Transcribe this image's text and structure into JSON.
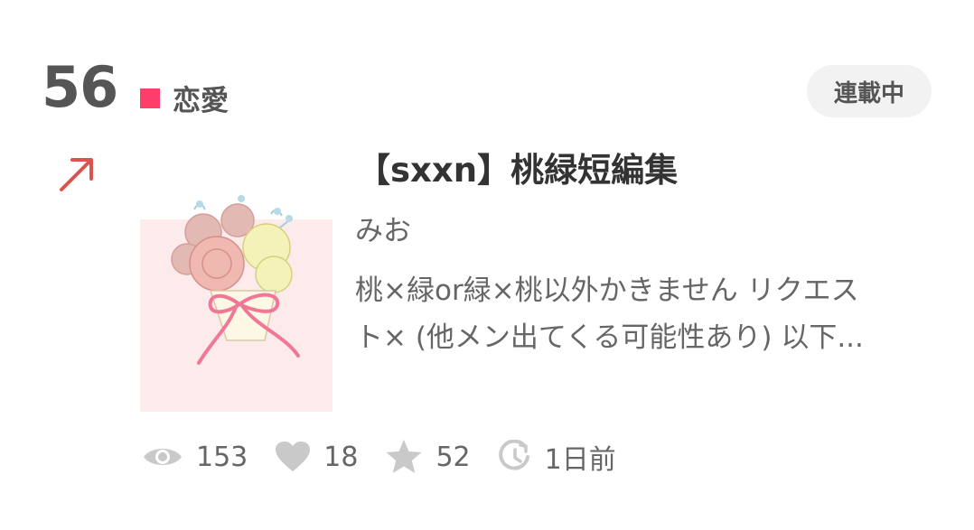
{
  "rank": "56",
  "genre": "恋愛",
  "status": "連載中",
  "trend": "up",
  "story": {
    "title": "【sxxn】桃緑短編集",
    "author": "みお",
    "summary_line1": "桃×緑or緑×桃以外かきません リクエス",
    "summary_line2": "ト× (他メン出てくる可能性あり) 以下..."
  },
  "stats": {
    "views": "153",
    "likes": "18",
    "stars": "52",
    "updated": "1日前"
  },
  "colors": {
    "genre_accent": "#ff3d6b",
    "trend_arrow": "#d9534f",
    "icon_gray": "#c9c9c9"
  },
  "icons": {
    "views": "eye-icon",
    "likes": "heart-icon",
    "stars": "star-icon",
    "updated": "clock-icon"
  }
}
